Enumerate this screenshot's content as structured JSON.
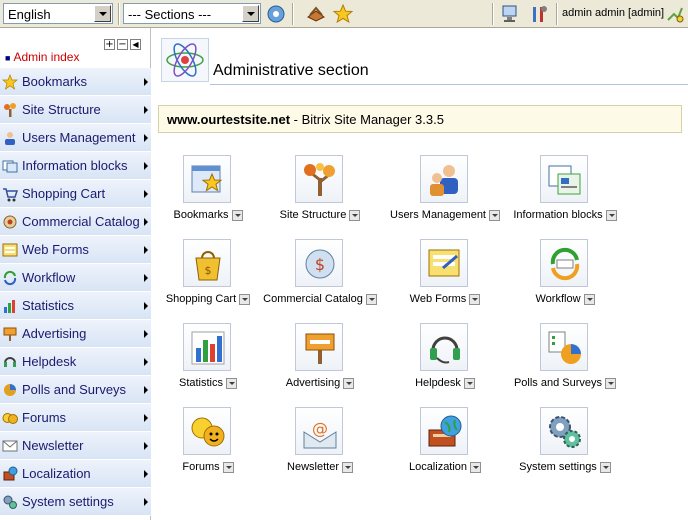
{
  "toolbar": {
    "language_value": "English",
    "sections_value": "--- Sections ---",
    "user_label": "admin admin [admin]"
  },
  "left": {
    "admin_index": "Admin index",
    "items": [
      {
        "label": "Bookmarks",
        "icon": "star-icon"
      },
      {
        "label": "Site Structure",
        "icon": "tree-icon"
      },
      {
        "label": "Users Management",
        "icon": "users-icon"
      },
      {
        "label": "Information blocks",
        "icon": "info-blocks-icon"
      },
      {
        "label": "Shopping Cart",
        "icon": "cart-icon"
      },
      {
        "label": "Commercial Catalog",
        "icon": "catalog-icon"
      },
      {
        "label": "Web Forms",
        "icon": "forms-icon"
      },
      {
        "label": "Workflow",
        "icon": "workflow-icon"
      },
      {
        "label": "Statistics",
        "icon": "statistics-icon"
      },
      {
        "label": "Advertising",
        "icon": "advertising-icon"
      },
      {
        "label": "Helpdesk",
        "icon": "helpdesk-icon"
      },
      {
        "label": "Polls and Surveys",
        "icon": "polls-icon"
      },
      {
        "label": "Forums",
        "icon": "forums-icon"
      },
      {
        "label": "Newsletter",
        "icon": "newsletter-icon"
      },
      {
        "label": "Localization",
        "icon": "localization-icon"
      },
      {
        "label": "System settings",
        "icon": "gears-icon"
      }
    ]
  },
  "main": {
    "title": "Administrative section",
    "site_domain": "www.ourtestsite.net",
    "site_suffix": " - Bitrix Site Manager 3.3.5",
    "tiles": [
      {
        "label": "Bookmarks"
      },
      {
        "label": "Site Structure"
      },
      {
        "label": "Users Management"
      },
      {
        "label": "Information blocks"
      },
      {
        "label": "Shopping Cart"
      },
      {
        "label": "Commercial Catalog"
      },
      {
        "label": "Web Forms"
      },
      {
        "label": "Workflow"
      },
      {
        "label": "Statistics"
      },
      {
        "label": "Advertising"
      },
      {
        "label": "Helpdesk"
      },
      {
        "label": "Polls and Surveys"
      },
      {
        "label": "Forums"
      },
      {
        "label": "Newsletter"
      },
      {
        "label": "Localization"
      },
      {
        "label": "System settings"
      }
    ]
  }
}
